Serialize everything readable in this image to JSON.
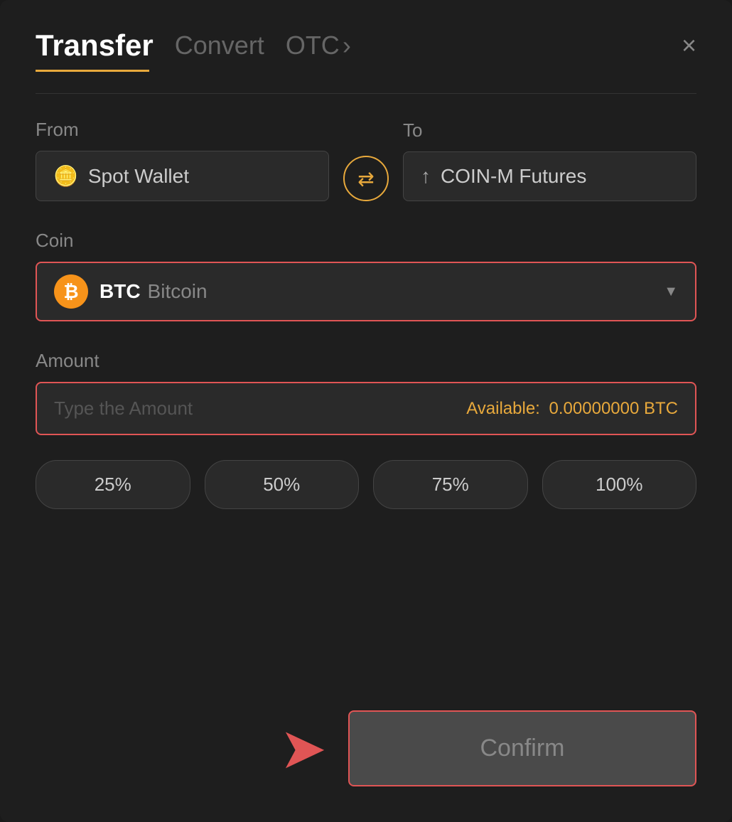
{
  "header": {
    "title": "Transfer",
    "tabs": [
      {
        "label": "Convert",
        "active": false
      },
      {
        "label": "OTC",
        "active": false,
        "hasChevron": true
      }
    ],
    "close_label": "×"
  },
  "from_field": {
    "label": "From",
    "icon": "💳",
    "value": "Spot Wallet"
  },
  "to_field": {
    "label": "To",
    "icon": "↑",
    "value": "COIN-M Futures"
  },
  "swap_icon": "⇄",
  "coin_section": {
    "label": "Coin",
    "coin_symbol": "BTC",
    "coin_name": "Bitcoin",
    "btc_symbol": "₿"
  },
  "amount_section": {
    "label": "Amount",
    "placeholder": "Type the Amount",
    "available_label": "Available:",
    "available_value": "0.00000000 BTC"
  },
  "pct_buttons": [
    {
      "label": "25%"
    },
    {
      "label": "50%"
    },
    {
      "label": "75%"
    },
    {
      "label": "100%"
    }
  ],
  "confirm_button": {
    "label": "Confirm"
  }
}
